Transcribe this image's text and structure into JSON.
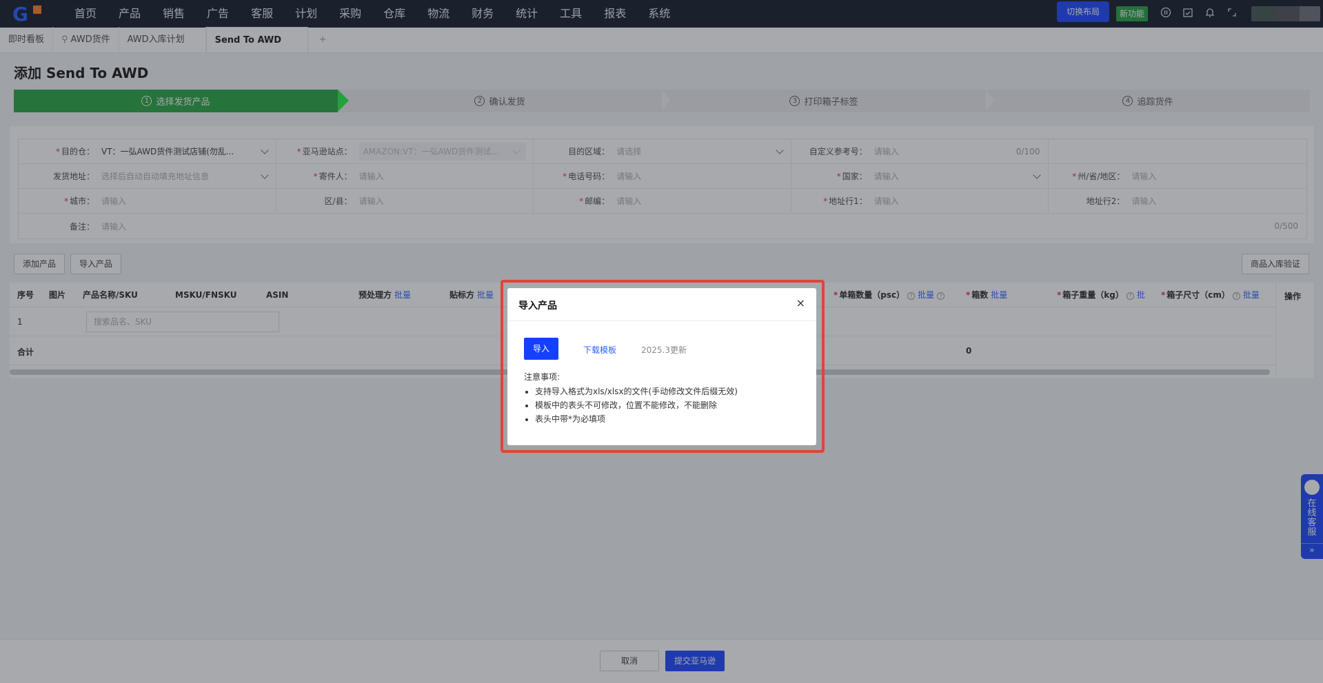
{
  "nav": {
    "items": [
      "首页",
      "产品",
      "销售",
      "广告",
      "客服",
      "计划",
      "采购",
      "仓库",
      "物流",
      "财务",
      "统计",
      "工具",
      "报表",
      "系统"
    ],
    "switch_layout": "切换布局",
    "new_feature": "新功能",
    "icons": [
      "info-icon",
      "calendar-check-icon",
      "bell-icon",
      "fullscreen-icon"
    ]
  },
  "tabs": {
    "items": [
      "即时看板",
      "AWD货件",
      "AWD入库计划",
      "Send To AWD"
    ],
    "add": "+"
  },
  "page": {
    "title": "添加 Send To AWD",
    "steps": [
      {
        "num": "1",
        "label": "选择发货产品"
      },
      {
        "num": "2",
        "label": "确认发货"
      },
      {
        "num": "3",
        "label": "打印箱子标签"
      },
      {
        "num": "4",
        "label": "追踪货件"
      }
    ]
  },
  "form": {
    "dest_warehouse": {
      "label": "目的仓：",
      "value": "VT：一弘AWD货件测试店铺(勿乱..."
    },
    "marketplace": {
      "label": "亚马逊站点：",
      "value": "AMAZON:VT：一弘AWD货件测试..."
    },
    "dest_region": {
      "label": "目的区域：",
      "placeholder": "请选择"
    },
    "custom_ref": {
      "label": "自定义参考号：",
      "placeholder": "请输入",
      "counter": "0/100"
    },
    "ship_address": {
      "label": "发货地址：",
      "placeholder": "选择后自动自动填充地址信息"
    },
    "sender": {
      "label": "寄件人：",
      "placeholder": "请输入"
    },
    "phone": {
      "label": "电话号码：",
      "placeholder": "请输入"
    },
    "country": {
      "label": "国家：",
      "placeholder": "请输入"
    },
    "state": {
      "label": "州/省/地区：",
      "placeholder": "请输入"
    },
    "city": {
      "label": "城市：",
      "placeholder": "请输入"
    },
    "district": {
      "label": "区/县：",
      "placeholder": "请输入"
    },
    "zipcode": {
      "label": "邮编：",
      "placeholder": "请输入"
    },
    "address1": {
      "label": "地址行1：",
      "placeholder": "请输入"
    },
    "address2": {
      "label": "地址行2：",
      "placeholder": "请输入"
    },
    "remark": {
      "label": "备注：",
      "placeholder": "请输入",
      "counter": "0/500"
    }
  },
  "actions": {
    "add_product": "添加产品",
    "import_product": "导入产品",
    "verify": "商品入库验证"
  },
  "table": {
    "headers": {
      "seq": "序号",
      "image": "图片",
      "name": "产品名称/SKU",
      "msku": "MSKU/FNSKU",
      "asin": "ASIN",
      "prep": "预处理方",
      "label_by": "贴标方",
      "per_box": "单箱数量（psc）",
      "boxes": "箱数",
      "weight": "箱子重量（kg）",
      "size": "箱子尺寸（cm）",
      "ops": "操作"
    },
    "bulk": "批量",
    "bulk_short": "批",
    "row_seq": "1",
    "search_placeholder": "搜索品名、SKU",
    "total_label": "合计",
    "total_boxes": "0"
  },
  "footer": {
    "cancel": "取消",
    "submit": "提交亚马逊"
  },
  "cs": {
    "text": "在线客服",
    "arrow": "»"
  },
  "modal": {
    "title": "导入产品",
    "close": "×",
    "import_btn": "导入",
    "download": "下载模板",
    "update_note": "2025.3更新",
    "notes_title": "注意事项:",
    "notes": [
      "支持导入格式为xls/xlsx的文件(手动修改文件后缀无效)",
      "模板中的表头不可修改，位置不能修改，不能删除",
      "表头中带*为必填项"
    ]
  }
}
